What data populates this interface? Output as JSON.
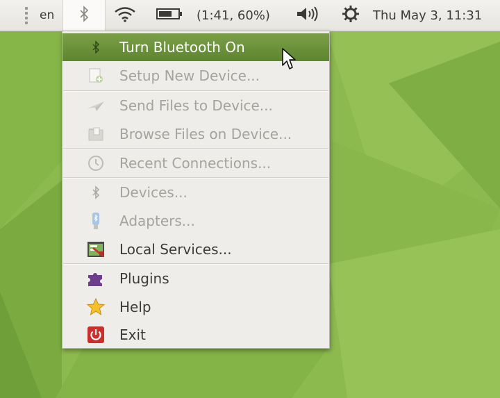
{
  "panel": {
    "language": "en",
    "battery_text": "(1:41, 60%)",
    "clock": "Thu May  3, 11:31",
    "icons": [
      "bluetooth-icon",
      "wifi-icon",
      "battery-icon",
      "volume-icon",
      "gear-icon"
    ]
  },
  "menu": {
    "items": [
      {
        "label": "Turn Bluetooth On",
        "icon": "bluetooth-icon",
        "state": "highlighted"
      },
      {
        "label": "Setup New Device...",
        "icon": "setup-device-icon",
        "state": "disabled"
      },
      {
        "label": "Send Files to Device...",
        "icon": "send-files-icon",
        "state": "disabled"
      },
      {
        "label": "Browse Files on Device...",
        "icon": "folder-icon",
        "state": "disabled"
      },
      {
        "label": "Recent Connections...",
        "icon": "recent-icon",
        "state": "disabled"
      },
      {
        "label": "Devices...",
        "icon": "bluetooth-icon",
        "state": "disabled"
      },
      {
        "label": "Adapters...",
        "icon": "adapter-icon",
        "state": "disabled"
      },
      {
        "label": "Local Services...",
        "icon": "local-services-icon",
        "state": "enabled"
      },
      {
        "label": "Plugins",
        "icon": "puzzle-icon",
        "state": "enabled"
      },
      {
        "label": "Help",
        "icon": "star-icon",
        "state": "enabled"
      },
      {
        "label": "Exit",
        "icon": "power-icon",
        "state": "enabled"
      }
    ]
  },
  "colors": {
    "accent": "#6a9140",
    "panel_bg": "#efede9",
    "desktop": "#8dba4e",
    "disabled_text": "#a5a39e"
  }
}
